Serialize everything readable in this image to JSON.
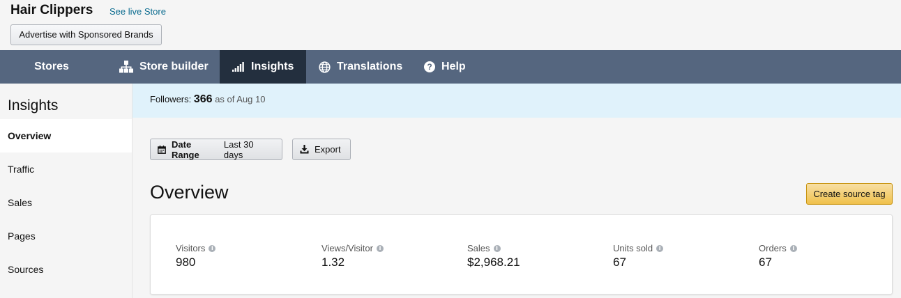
{
  "header": {
    "store_title": "Hair Clippers",
    "live_link": "See live Store",
    "advertise_button": "Advertise with Sponsored Brands"
  },
  "nav": {
    "items": [
      {
        "label": "Stores",
        "icon": "none"
      },
      {
        "label": "Store builder",
        "icon": "sitemap-icon"
      },
      {
        "label": "Insights",
        "icon": "signal-bars-icon",
        "active": true
      },
      {
        "label": "Translations",
        "icon": "globe-icon"
      },
      {
        "label": "Help",
        "icon": "question-circle-icon"
      }
    ]
  },
  "sidebar": {
    "title": "Insights",
    "items": [
      {
        "label": "Overview",
        "active": true
      },
      {
        "label": "Traffic"
      },
      {
        "label": "Sales"
      },
      {
        "label": "Pages"
      },
      {
        "label": "Sources"
      }
    ]
  },
  "followers": {
    "label": "Followers:",
    "count": "366",
    "as_of": "as of Aug 10"
  },
  "toolbar": {
    "date_range_label": "Date Range",
    "date_range_value": "Last 30 days",
    "export_label": "Export"
  },
  "overview": {
    "title": "Overview",
    "source_tag_button": "Create source tag",
    "metrics": [
      {
        "label": "Visitors",
        "value": "980"
      },
      {
        "label": "Views/Visitor",
        "value": "1.32"
      },
      {
        "label": "Sales",
        "value": "$2,968.21"
      },
      {
        "label": "Units sold",
        "value": "67"
      },
      {
        "label": "Orders",
        "value": "67"
      }
    ]
  },
  "colors": {
    "nav_bg": "#55667f",
    "nav_active": "#232f3e",
    "followers_bar": "#e0f2fb",
    "accent_button": "#f0c14b",
    "link": "#0a6b8f"
  }
}
